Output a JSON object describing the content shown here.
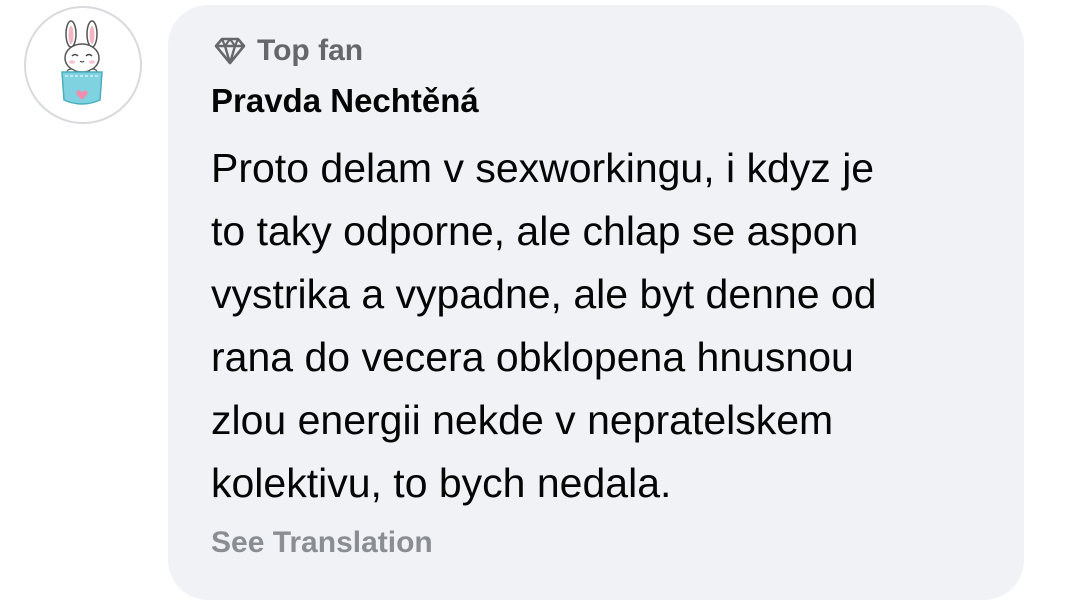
{
  "comment": {
    "avatar_icon": "bunny-in-pocket-avatar",
    "badge": {
      "icon": "diamond-icon",
      "label": "Top fan"
    },
    "author": "Pravda Nechtěná",
    "text_lines": [
      "Proto delam v sexworkingu, i kdyz je",
      "to taky odporne, ale chlap se aspon",
      "vystrika a vypadne, ale byt denne od",
      "rana do vecera obklopena hnusnou",
      "zlou energii nekde v nepratelskem",
      "kolektivu, to bych nedala."
    ],
    "translate_label": "See Translation"
  },
  "colors": {
    "bubble_bg": "#f0f2f5",
    "primary_text": "#050505",
    "secondary_text": "#65676b",
    "link_muted": "#8a8d91"
  }
}
